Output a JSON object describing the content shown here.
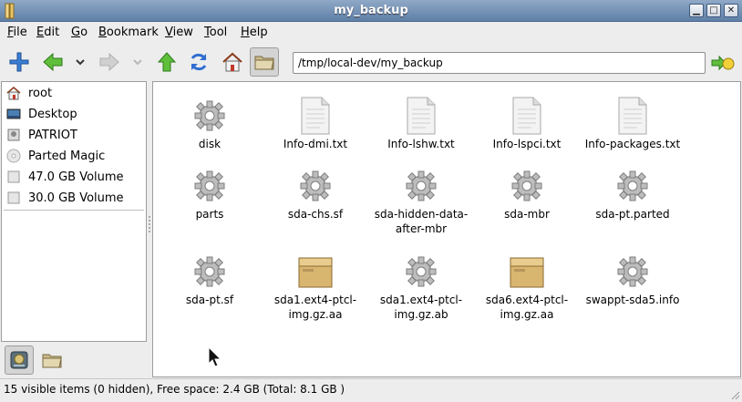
{
  "window": {
    "title": "my_backup",
    "controls": {
      "minimize": "▁",
      "maximize": "□",
      "close": "✕"
    }
  },
  "menubar": {
    "items": [
      {
        "pre": "",
        "u": "F",
        "post": "ile"
      },
      {
        "pre": "",
        "u": "E",
        "post": "dit"
      },
      {
        "pre": "",
        "u": "G",
        "post": "o"
      },
      {
        "pre": "",
        "u": "B",
        "post": "ookmark"
      },
      {
        "pre": "",
        "u": "V",
        "post": "iew"
      },
      {
        "pre": "",
        "u": "T",
        "post": "ool"
      },
      {
        "pre": "",
        "u": "H",
        "post": "elp"
      }
    ]
  },
  "toolbar": {
    "icons": [
      "new-tab-icon",
      "back-icon",
      "back-history-icon",
      "forward-icon",
      "forward-history-icon",
      "up-icon",
      "reload-icon",
      "home-icon",
      "open-folder-icon"
    ],
    "address": "/tmp/local-dev/my_backup",
    "go_icon": "go-icon"
  },
  "sidebar": {
    "items": [
      {
        "label": "root",
        "icon": "home-icon"
      },
      {
        "label": "Desktop",
        "icon": "desktop-icon"
      },
      {
        "label": "PATRIOT",
        "icon": "usb-drive-icon"
      },
      {
        "label": "Parted Magic",
        "icon": "cdrom-icon"
      },
      {
        "label": "47.0 GB Volume",
        "icon": "drive-icon"
      },
      {
        "label": "30.0 GB Volume",
        "icon": "drive-icon"
      }
    ],
    "tabs": [
      "places-icon",
      "directory-tree-icon"
    ]
  },
  "files": [
    {
      "name": "disk",
      "type": "executable"
    },
    {
      "name": "Info-dmi.txt",
      "type": "text"
    },
    {
      "name": "Info-lshw.txt",
      "type": "text"
    },
    {
      "name": "Info-lspci.txt",
      "type": "text"
    },
    {
      "name": "Info-packages.txt",
      "type": "text"
    },
    {
      "name": "parts",
      "type": "executable"
    },
    {
      "name": "sda-chs.sf",
      "type": "executable"
    },
    {
      "name": "sda-hidden-data-after-mbr",
      "type": "executable"
    },
    {
      "name": "sda-mbr",
      "type": "executable"
    },
    {
      "name": "sda-pt.parted",
      "type": "executable"
    },
    {
      "name": "sda-pt.sf",
      "type": "executable"
    },
    {
      "name": "sda1.ext4-ptcl-img.gz.aa",
      "type": "archive"
    },
    {
      "name": "sda1.ext4-ptcl-img.gz.ab",
      "type": "executable"
    },
    {
      "name": "sda6.ext4-ptcl-img.gz.aa",
      "type": "archive"
    },
    {
      "name": "swappt-sda5.info",
      "type": "executable"
    }
  ],
  "status": {
    "text": "15 visible items (0 hidden), Free space: 2.4 GB (Total: 8.1 GB )"
  },
  "colors": {
    "titlebar": "#6f8db4",
    "arrow_green": "#2e9a2a",
    "reload_blue": "#2f6fd0"
  }
}
